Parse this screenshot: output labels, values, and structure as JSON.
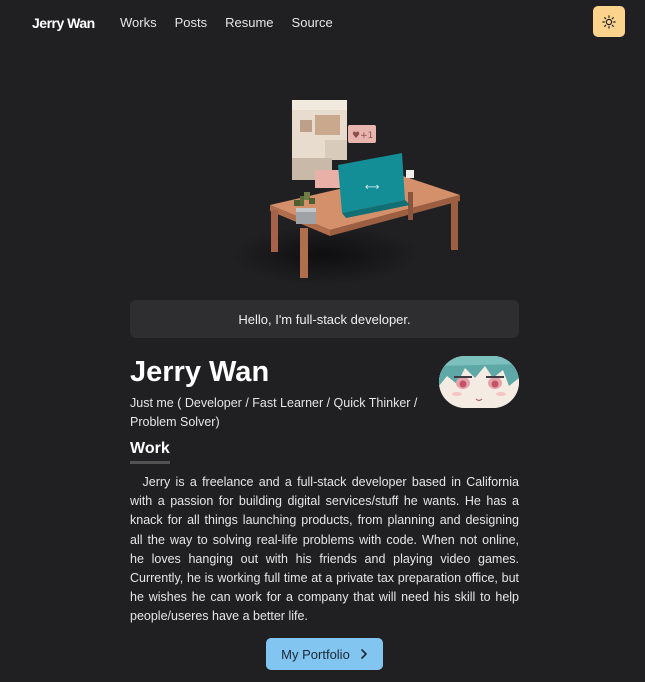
{
  "nav": {
    "logo": "Jerry Wan",
    "links": [
      "Works",
      "Posts",
      "Resume",
      "Source"
    ],
    "theme_toggle_icon": "sun-icon",
    "theme_toggle_color": "#fbd38d"
  },
  "hero": {
    "illustration": "voxel-character-desk-laptop"
  },
  "greeting": "Hello, I'm full-stack developer.",
  "profile": {
    "name": "Jerry Wan",
    "subtitle": "Just me ( Developer / Fast Learner / Quick Thinker / Problem Solver)",
    "avatar": "anime-avatar"
  },
  "work": {
    "heading": "Work",
    "body": "Jerry is a freelance and a full-stack developer based in California with a passion for building digital services/stuff he wants. He has a knack for all things launching products, from planning and designing all the way to solving real-life problems with code. When not online, he loves hanging out with his friends and playing video games. Currently, he is working full time at a private tax preparation office, but he wishes he can work for a company that will need his skill to help people/useres have a better life."
  },
  "cta": {
    "label": "My Portfolio",
    "icon": "chevron-right-icon",
    "color": "#81c5f0"
  },
  "colors": {
    "background": "#202023",
    "card": "#2e2e31"
  }
}
